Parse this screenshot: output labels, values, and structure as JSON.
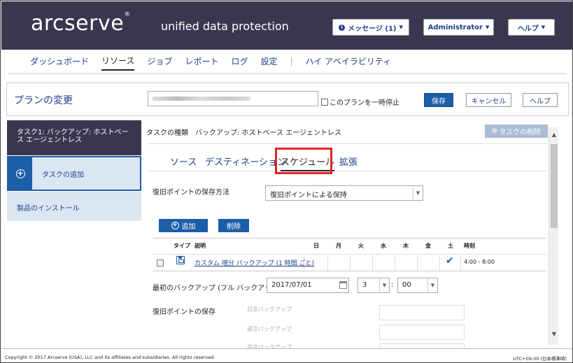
{
  "header": {
    "logo": "arcserve",
    "logo_mark": "®",
    "product": "unified data protection",
    "messages_label": "メッセージ (1)",
    "user_label": "Administrator",
    "help_label": "ヘルプ"
  },
  "nav": {
    "items": [
      "ダッシュボード",
      "リソース",
      "ジョブ",
      "レポート",
      "ログ",
      "設定",
      "ハイ アベイラビリティ"
    ],
    "active": "リソース"
  },
  "plan": {
    "title": "プランの変更",
    "pause_label": "このプランを一時停止",
    "save_label": "保存",
    "cancel_label": "キャンセル",
    "help_label": "ヘルプ"
  },
  "left": {
    "task_label": "タスク1: バックアップ: ホストベース エージェントレス",
    "add_task_label": "タスクの追加",
    "install_label": "製品のインストール"
  },
  "main": {
    "task_type": "タスクの種類　バックアップ: ホストベース エージェントレス",
    "delete_task_label": "タスクの削除",
    "tabs": [
      "ソース",
      "デスティネーション",
      "スケジュール",
      "拡張"
    ],
    "active_tab": "スケジュール",
    "retention_method_label": "復旧ポイントの保存方法",
    "retention_method_value": "復旧ポイントによる保持",
    "add_button": "追加",
    "delete_button": "削除",
    "schedule_table": {
      "headers": [
        "タイプ",
        "説明",
        "日",
        "月",
        "火",
        "水",
        "木",
        "金",
        "土",
        "時刻"
      ],
      "row": {
        "description": "カスタム 増分 バックアップ (1 時間 ごと)",
        "time": "4:00 - 8:00"
      }
    },
    "first_backup_label": "最初のバックアップ (フル バックアップ)",
    "first_backup_date": "2017/07/01",
    "first_backup_hour": "3",
    "first_backup_minute": "00",
    "retention_label": "復旧ポイントの保存",
    "retention_daily": "日次バックアップ",
    "retention_weekly": "週次バックアップ",
    "retention_monthly": "月次バックアップ"
  },
  "footer": {
    "copyright": "Copyright © 2017 Arcserve (USA), LLC and its affiliates and subsidiaries. All rights reserved.",
    "timezone": "UTC+09:00 (日本標準時)"
  },
  "colors": {
    "header_bg": "#3b3650",
    "accent": "#1c5ea8",
    "highlight": "#e0242a"
  }
}
